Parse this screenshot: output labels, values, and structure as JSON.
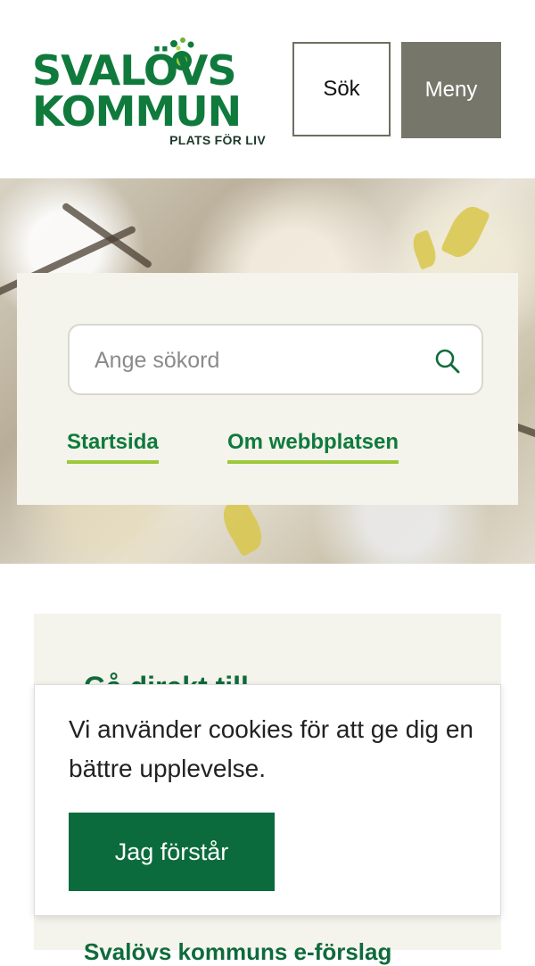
{
  "header": {
    "logo_line1": "SVALÖVS",
    "logo_line2": "KOMMUN",
    "logo_tagline": "PLATS FÖR LIV",
    "search_button": "Sök",
    "menu_button": "Meny"
  },
  "search": {
    "placeholder": "Ange sökord",
    "icon": "search-icon"
  },
  "quick_links": [
    {
      "label": "Startsida"
    },
    {
      "label": "Om webbplatsen"
    }
  ],
  "goto": {
    "title": "Gå direkt till",
    "first_link": "Svalövs kommuns e-förslag"
  },
  "cookie": {
    "message": "Vi använder cookies för att ge dig en bättre upplevelse.",
    "accept": "Jag förstår"
  },
  "colors": {
    "brand_green": "#0f7a3c",
    "accent_lime": "#9bc93a",
    "menu_bg": "#76776a",
    "panel_bg": "#f4f3ec"
  }
}
